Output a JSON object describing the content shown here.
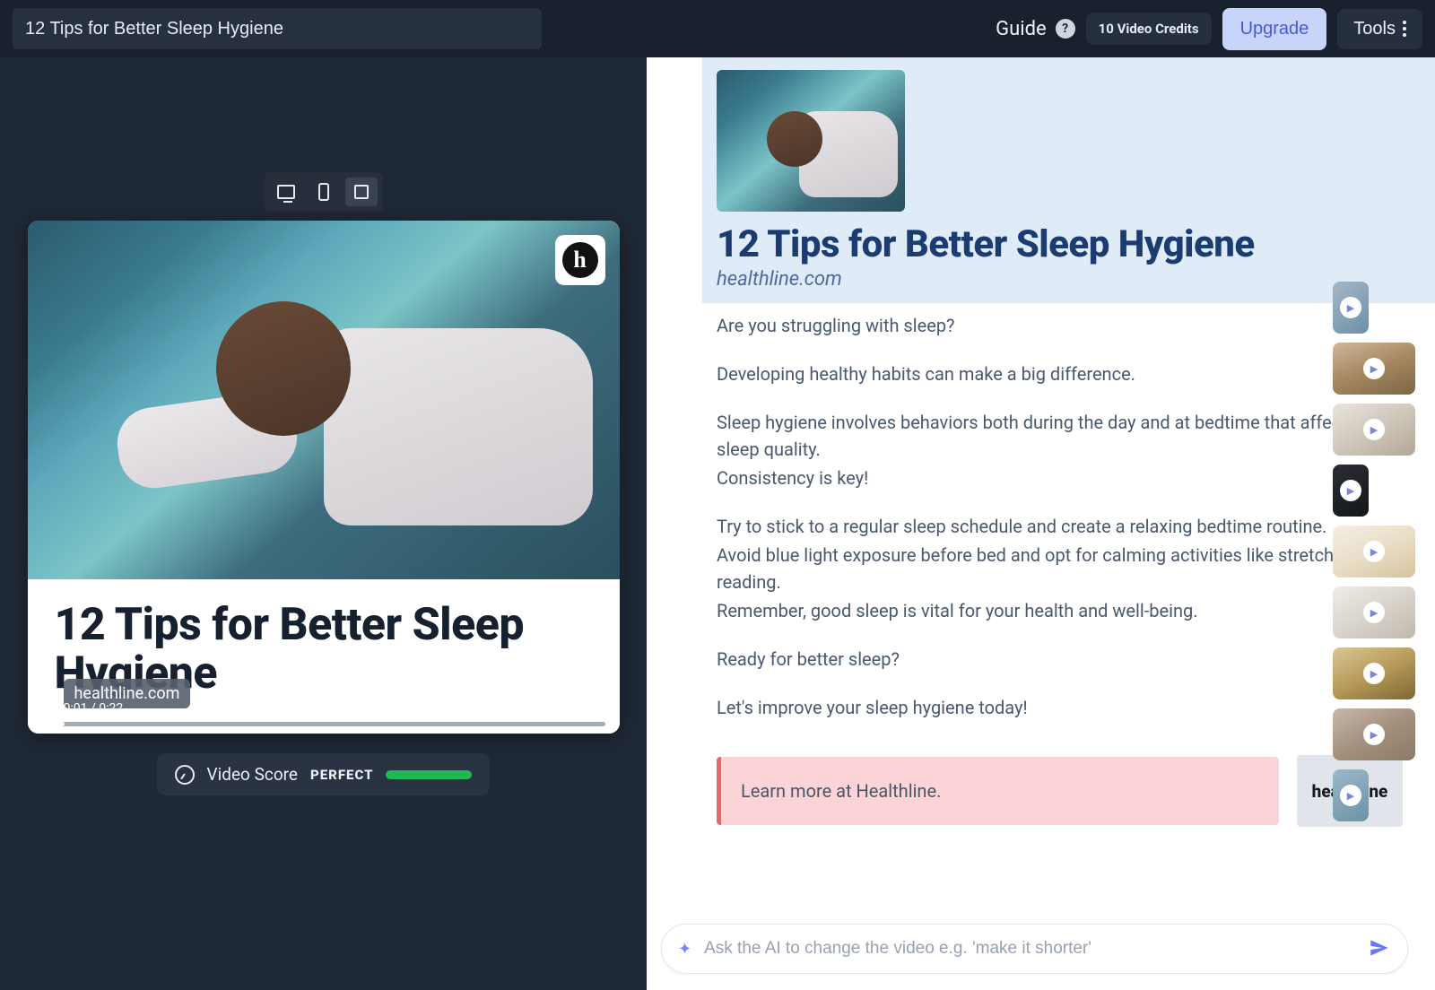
{
  "topbar": {
    "title_value": "12 Tips for Better Sleep Hygiene",
    "guide_label": "Guide",
    "help_glyph": "?",
    "credits_label": "10 Video Credits",
    "upgrade_label": "Upgrade",
    "tools_label": "Tools"
  },
  "preview": {
    "title": "12 Tips for Better Sleep Hygiene",
    "logo_letter": "h",
    "time_current": "0:01",
    "time_total": "0:22",
    "site_label": "healthline.com"
  },
  "score": {
    "label": "Video Score",
    "badge": "PERFECT"
  },
  "document": {
    "title": "12 Tips for Better Sleep Hygiene",
    "site": "healthline.com",
    "p1": "Are you struggling with sleep?",
    "p2": "Developing healthy habits can make a big difference.",
    "p3": "Sleep hygiene involves behaviors both during the day and at bedtime that affect your sleep quality.",
    "p4": "Consistency is key!",
    "p5": "Try to stick to a regular sleep schedule and create a relaxing bedtime routine.",
    "p6": "Avoid blue light exposure before bed and opt for calming activities like stretching or reading.",
    "p7": "Remember, good sleep is vital for your health and well-being.",
    "p8": "Ready for better sleep?",
    "p9": "Let's improve your sleep hygiene today!",
    "callout_text": "Learn more at Healthline.",
    "healthline_mark": "healthline"
  },
  "prompt": {
    "placeholder": "Ask the AI to change the video e.g. 'make it shorter'"
  },
  "mini_tools": {
    "add": "+",
    "gear": "⚙",
    "grip": "⠿"
  }
}
